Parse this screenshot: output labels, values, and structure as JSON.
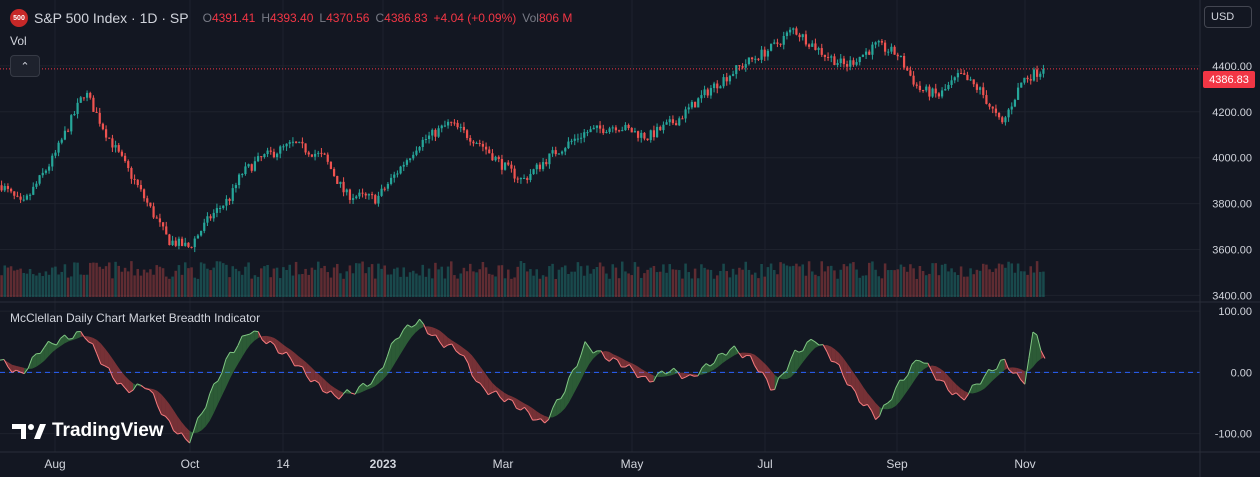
{
  "header": {
    "logo_text": "500",
    "symbol_title": "S&P 500 Index · 1D · SP",
    "open_label": "O",
    "open_value": "4391.41",
    "high_label": "H",
    "high_value": "4393.40",
    "low_label": "L",
    "low_value": "4370.56",
    "close_label": "C",
    "close_value": "4386.83",
    "change_value": "+4.04 (+0.09%)",
    "vol_label": "Vol",
    "vol_value": "806 M"
  },
  "volume_pane_label": "Vol",
  "collapse_icon": "chevron-up-icon",
  "currency": "USD",
  "last_price_tag": "4386.83",
  "indicator_label": "McClellan Daily Chart Market Breadth Indicator",
  "brand_text": "TradingView",
  "colors": {
    "up": "#26a69a",
    "down": "#ef5350",
    "bg": "#131722",
    "grid": "#1e222d",
    "tag": "#f23645",
    "zero_line": "#2962ff"
  },
  "chart_data": [
    {
      "type": "candlestick",
      "title": "S&P 500 Index · 1D · SP",
      "x_ticks": [
        "Aug",
        "Oct",
        "14",
        "2023",
        "Mar",
        "May",
        "Jul",
        "Sep",
        "Nov"
      ],
      "y_ticks": [
        "3400.00",
        "3600.00",
        "3800.00",
        "4000.00",
        "4200.00",
        "4400.00"
      ],
      "ylim": [
        3380,
        4600
      ],
      "last_price": 4386.83,
      "close_path": [
        {
          "t": 0,
          "v": 3880
        },
        {
          "t": 0.02,
          "v": 3790
        },
        {
          "t": 0.05,
          "v": 4000
        },
        {
          "t": 0.08,
          "v": 4290
        },
        {
          "t": 0.1,
          "v": 4110
        },
        {
          "t": 0.13,
          "v": 3880
        },
        {
          "t": 0.16,
          "v": 3640
        },
        {
          "t": 0.18,
          "v": 3610
        },
        {
          "t": 0.2,
          "v": 3740
        },
        {
          "t": 0.22,
          "v": 3830
        },
        {
          "t": 0.23,
          "v": 3930
        },
        {
          "t": 0.25,
          "v": 4000
        },
        {
          "t": 0.28,
          "v": 4060
        },
        {
          "t": 0.31,
          "v": 4000
        },
        {
          "t": 0.33,
          "v": 3840
        },
        {
          "t": 0.36,
          "v": 3820
        },
        {
          "t": 0.4,
          "v": 4060
        },
        {
          "t": 0.43,
          "v": 4150
        },
        {
          "t": 0.46,
          "v": 4060
        },
        {
          "t": 0.48,
          "v": 3970
        },
        {
          "t": 0.5,
          "v": 3900
        },
        {
          "t": 0.53,
          "v": 4020
        },
        {
          "t": 0.56,
          "v": 4110
        },
        {
          "t": 0.59,
          "v": 4140
        },
        {
          "t": 0.62,
          "v": 4090
        },
        {
          "t": 0.65,
          "v": 4170
        },
        {
          "t": 0.68,
          "v": 4300
        },
        {
          "t": 0.71,
          "v": 4400
        },
        {
          "t": 0.74,
          "v": 4480
        },
        {
          "t": 0.76,
          "v": 4560
        },
        {
          "t": 0.79,
          "v": 4450
        },
        {
          "t": 0.81,
          "v": 4400
        },
        {
          "t": 0.84,
          "v": 4490
        },
        {
          "t": 0.86,
          "v": 4450
        },
        {
          "t": 0.88,
          "v": 4300
        },
        {
          "t": 0.9,
          "v": 4270
        },
        {
          "t": 0.92,
          "v": 4360
        },
        {
          "t": 0.94,
          "v": 4290
        },
        {
          "t": 0.96,
          "v": 4140
        },
        {
          "t": 0.98,
          "v": 4340
        },
        {
          "t": 1,
          "v": 4386.83
        }
      ]
    },
    {
      "type": "area",
      "title": "McClellan Daily Chart Market Breadth Indicator",
      "y_ticks": [
        "100.00",
        "0.00",
        "-100.00"
      ],
      "ylim": [
        -130,
        115
      ],
      "zero_line": 0,
      "osc_path": [
        {
          "t": 0,
          "v": 20
        },
        {
          "t": 0.02,
          "v": -5
        },
        {
          "t": 0.04,
          "v": 40
        },
        {
          "t": 0.06,
          "v": 55
        },
        {
          "t": 0.08,
          "v": 65
        },
        {
          "t": 0.1,
          "v": 10
        },
        {
          "t": 0.12,
          "v": -30
        },
        {
          "t": 0.14,
          "v": -20
        },
        {
          "t": 0.16,
          "v": -80
        },
        {
          "t": 0.18,
          "v": -115
        },
        {
          "t": 0.2,
          "v": -40
        },
        {
          "t": 0.22,
          "v": 30
        },
        {
          "t": 0.24,
          "v": 70
        },
        {
          "t": 0.26,
          "v": 45
        },
        {
          "t": 0.28,
          "v": 20
        },
        {
          "t": 0.3,
          "v": -15
        },
        {
          "t": 0.32,
          "v": -40
        },
        {
          "t": 0.34,
          "v": -30
        },
        {
          "t": 0.36,
          "v": -10
        },
        {
          "t": 0.38,
          "v": 60
        },
        {
          "t": 0.4,
          "v": 85
        },
        {
          "t": 0.42,
          "v": 50
        },
        {
          "t": 0.44,
          "v": 35
        },
        {
          "t": 0.46,
          "v": -25
        },
        {
          "t": 0.48,
          "v": -40
        },
        {
          "t": 0.5,
          "v": -60
        },
        {
          "t": 0.52,
          "v": -85
        },
        {
          "t": 0.54,
          "v": -30
        },
        {
          "t": 0.56,
          "v": 45
        },
        {
          "t": 0.58,
          "v": 25
        },
        {
          "t": 0.6,
          "v": 10
        },
        {
          "t": 0.62,
          "v": -15
        },
        {
          "t": 0.64,
          "v": 5
        },
        {
          "t": 0.66,
          "v": -10
        },
        {
          "t": 0.68,
          "v": 15
        },
        {
          "t": 0.7,
          "v": 40
        },
        {
          "t": 0.72,
          "v": 20
        },
        {
          "t": 0.74,
          "v": -30
        },
        {
          "t": 0.76,
          "v": 30
        },
        {
          "t": 0.78,
          "v": 55
        },
        {
          "t": 0.8,
          "v": 15
        },
        {
          "t": 0.82,
          "v": -40
        },
        {
          "t": 0.84,
          "v": -75
        },
        {
          "t": 0.86,
          "v": -20
        },
        {
          "t": 0.88,
          "v": 25
        },
        {
          "t": 0.9,
          "v": -15
        },
        {
          "t": 0.92,
          "v": -45
        },
        {
          "t": 0.94,
          "v": -10
        },
        {
          "t": 0.96,
          "v": 20
        },
        {
          "t": 0.98,
          "v": -20
        },
        {
          "t": 0.99,
          "v": 75
        },
        {
          "t": 1,
          "v": 20
        }
      ]
    }
  ]
}
